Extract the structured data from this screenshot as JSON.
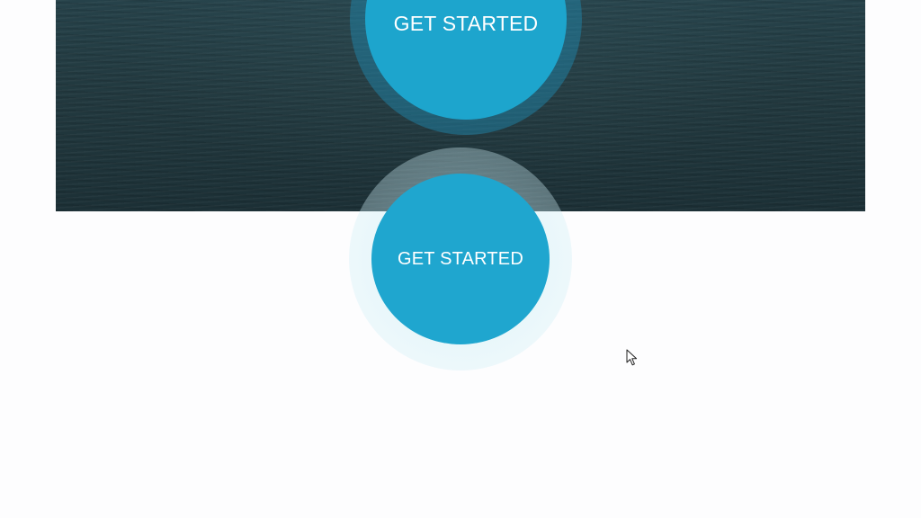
{
  "hero": {
    "image": "ocean-water-texture",
    "colors": {
      "dark_water": "#22393f",
      "mid_water": "#26424a"
    }
  },
  "buttons": {
    "top_label": "GET STARTED",
    "bottom_label": "GET STARTED",
    "color": "#1da5cd",
    "ring_color_dark": "#208cb4",
    "ring_color_light": "#bee8f2"
  },
  "cursor": {
    "icon": "mouse-pointer-icon"
  },
  "page": {
    "background": "#fdfdfe"
  }
}
